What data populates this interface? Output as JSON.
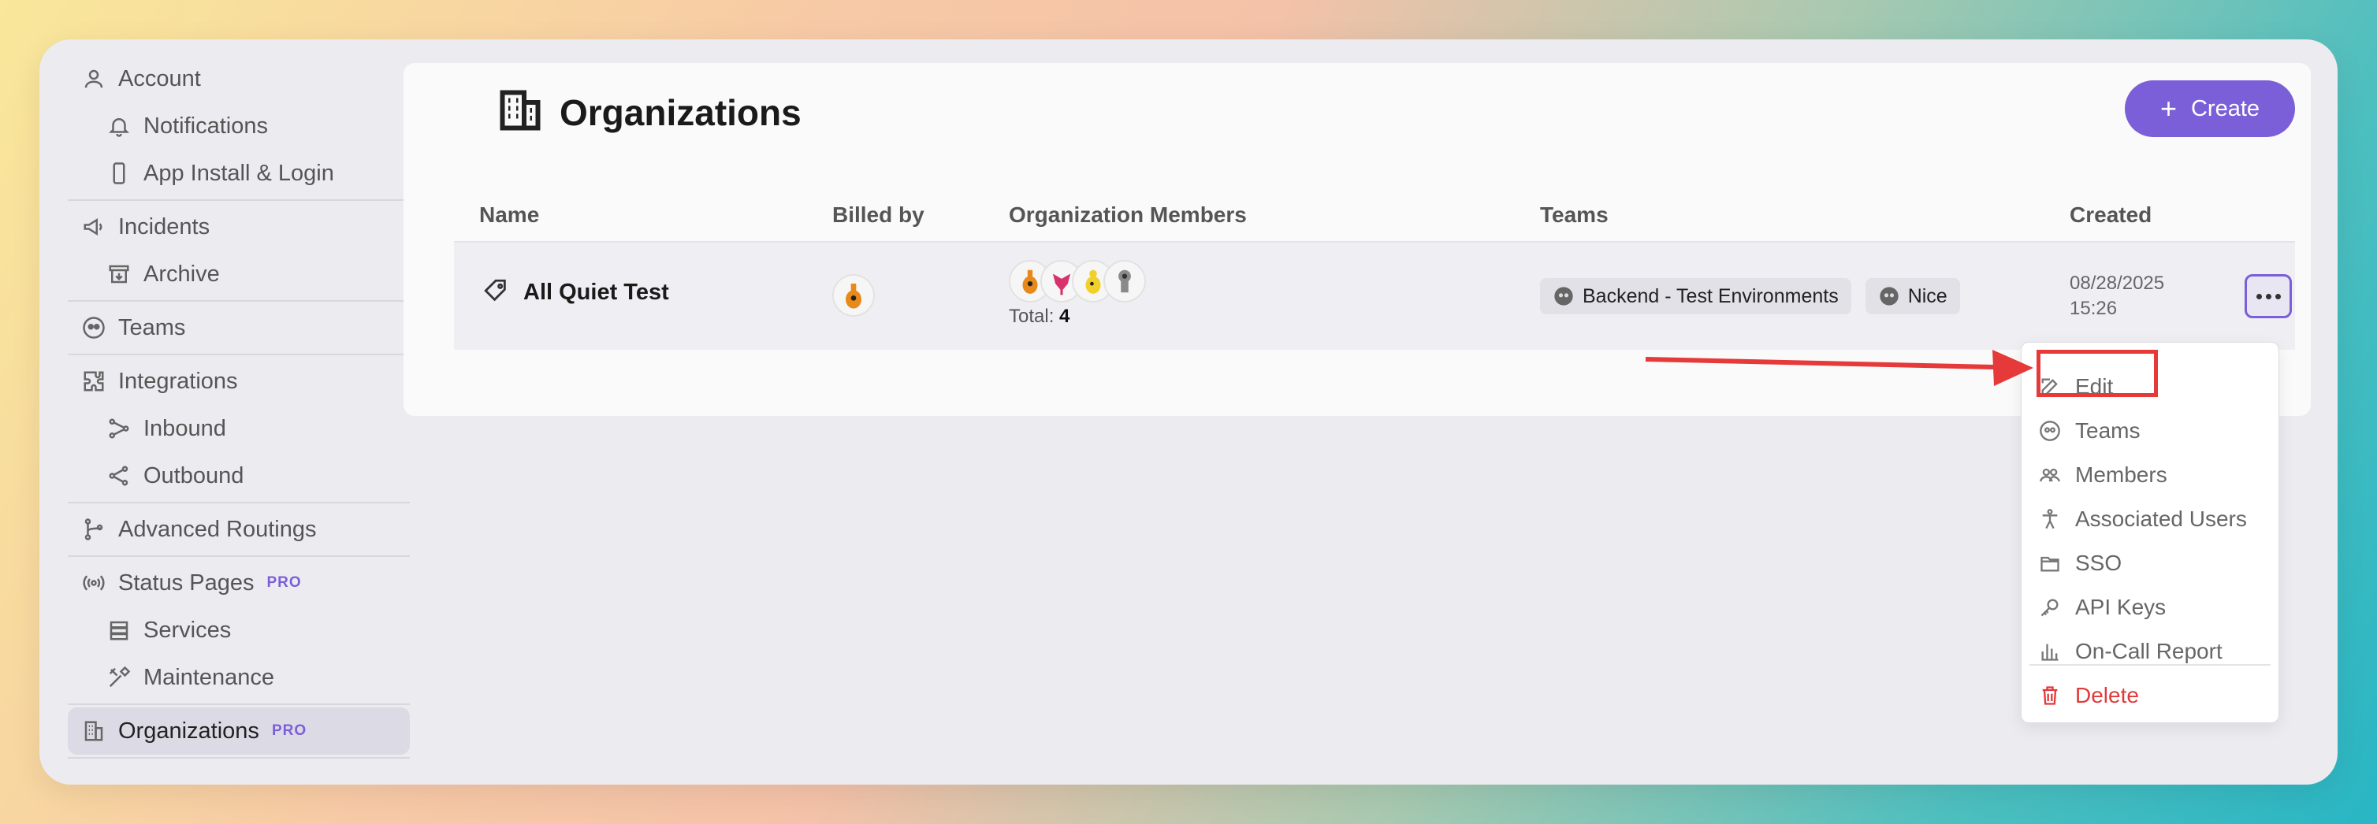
{
  "sidebar": {
    "items": [
      {
        "label": "Account",
        "icon": "user-icon"
      },
      {
        "label": "Notifications",
        "icon": "bell-icon"
      },
      {
        "label": "App Install & Login",
        "icon": "phone-icon"
      },
      {
        "label": "Incidents",
        "icon": "megaphone-icon"
      },
      {
        "label": "Archive",
        "icon": "archive-icon"
      },
      {
        "label": "Teams",
        "icon": "team-icon"
      },
      {
        "label": "Integrations",
        "icon": "puzzle-icon"
      },
      {
        "label": "Inbound",
        "icon": "inbound-icon"
      },
      {
        "label": "Outbound",
        "icon": "share-icon"
      },
      {
        "label": "Advanced Routings",
        "icon": "branch-icon"
      },
      {
        "label": "Status Pages",
        "icon": "broadcast-icon",
        "badge": "PRO"
      },
      {
        "label": "Services",
        "icon": "server-icon"
      },
      {
        "label": "Maintenance",
        "icon": "tools-icon"
      },
      {
        "label": "Organizations",
        "icon": "building-icon",
        "badge": "PRO",
        "active": true
      }
    ]
  },
  "header": {
    "title": "Organizations",
    "create_label": "Create"
  },
  "table": {
    "columns": [
      "Name",
      "Billed by",
      "Organization Members",
      "Teams",
      "Created"
    ],
    "rows": [
      {
        "name": "All Quiet Test",
        "members_total_label": "Total:",
        "members_total": "4",
        "teams": [
          "Backend - Test Environments",
          "Nice"
        ],
        "created_date": "08/28/2025",
        "created_time": "15:26"
      }
    ]
  },
  "menu": {
    "items": [
      {
        "label": "Edit",
        "icon": "edit-icon"
      },
      {
        "label": "Teams",
        "icon": "team-icon"
      },
      {
        "label": "Members",
        "icon": "members-icon"
      },
      {
        "label": "Associated Users",
        "icon": "person-icon"
      },
      {
        "label": "SSO",
        "icon": "folder-icon"
      },
      {
        "label": "API Keys",
        "icon": "key-icon"
      },
      {
        "label": "On-Call Report",
        "icon": "chart-icon"
      }
    ],
    "delete_label": "Delete"
  },
  "colors": {
    "accent": "#7b5fd8",
    "danger": "#e03a3a",
    "annotation": "#e5393a"
  }
}
